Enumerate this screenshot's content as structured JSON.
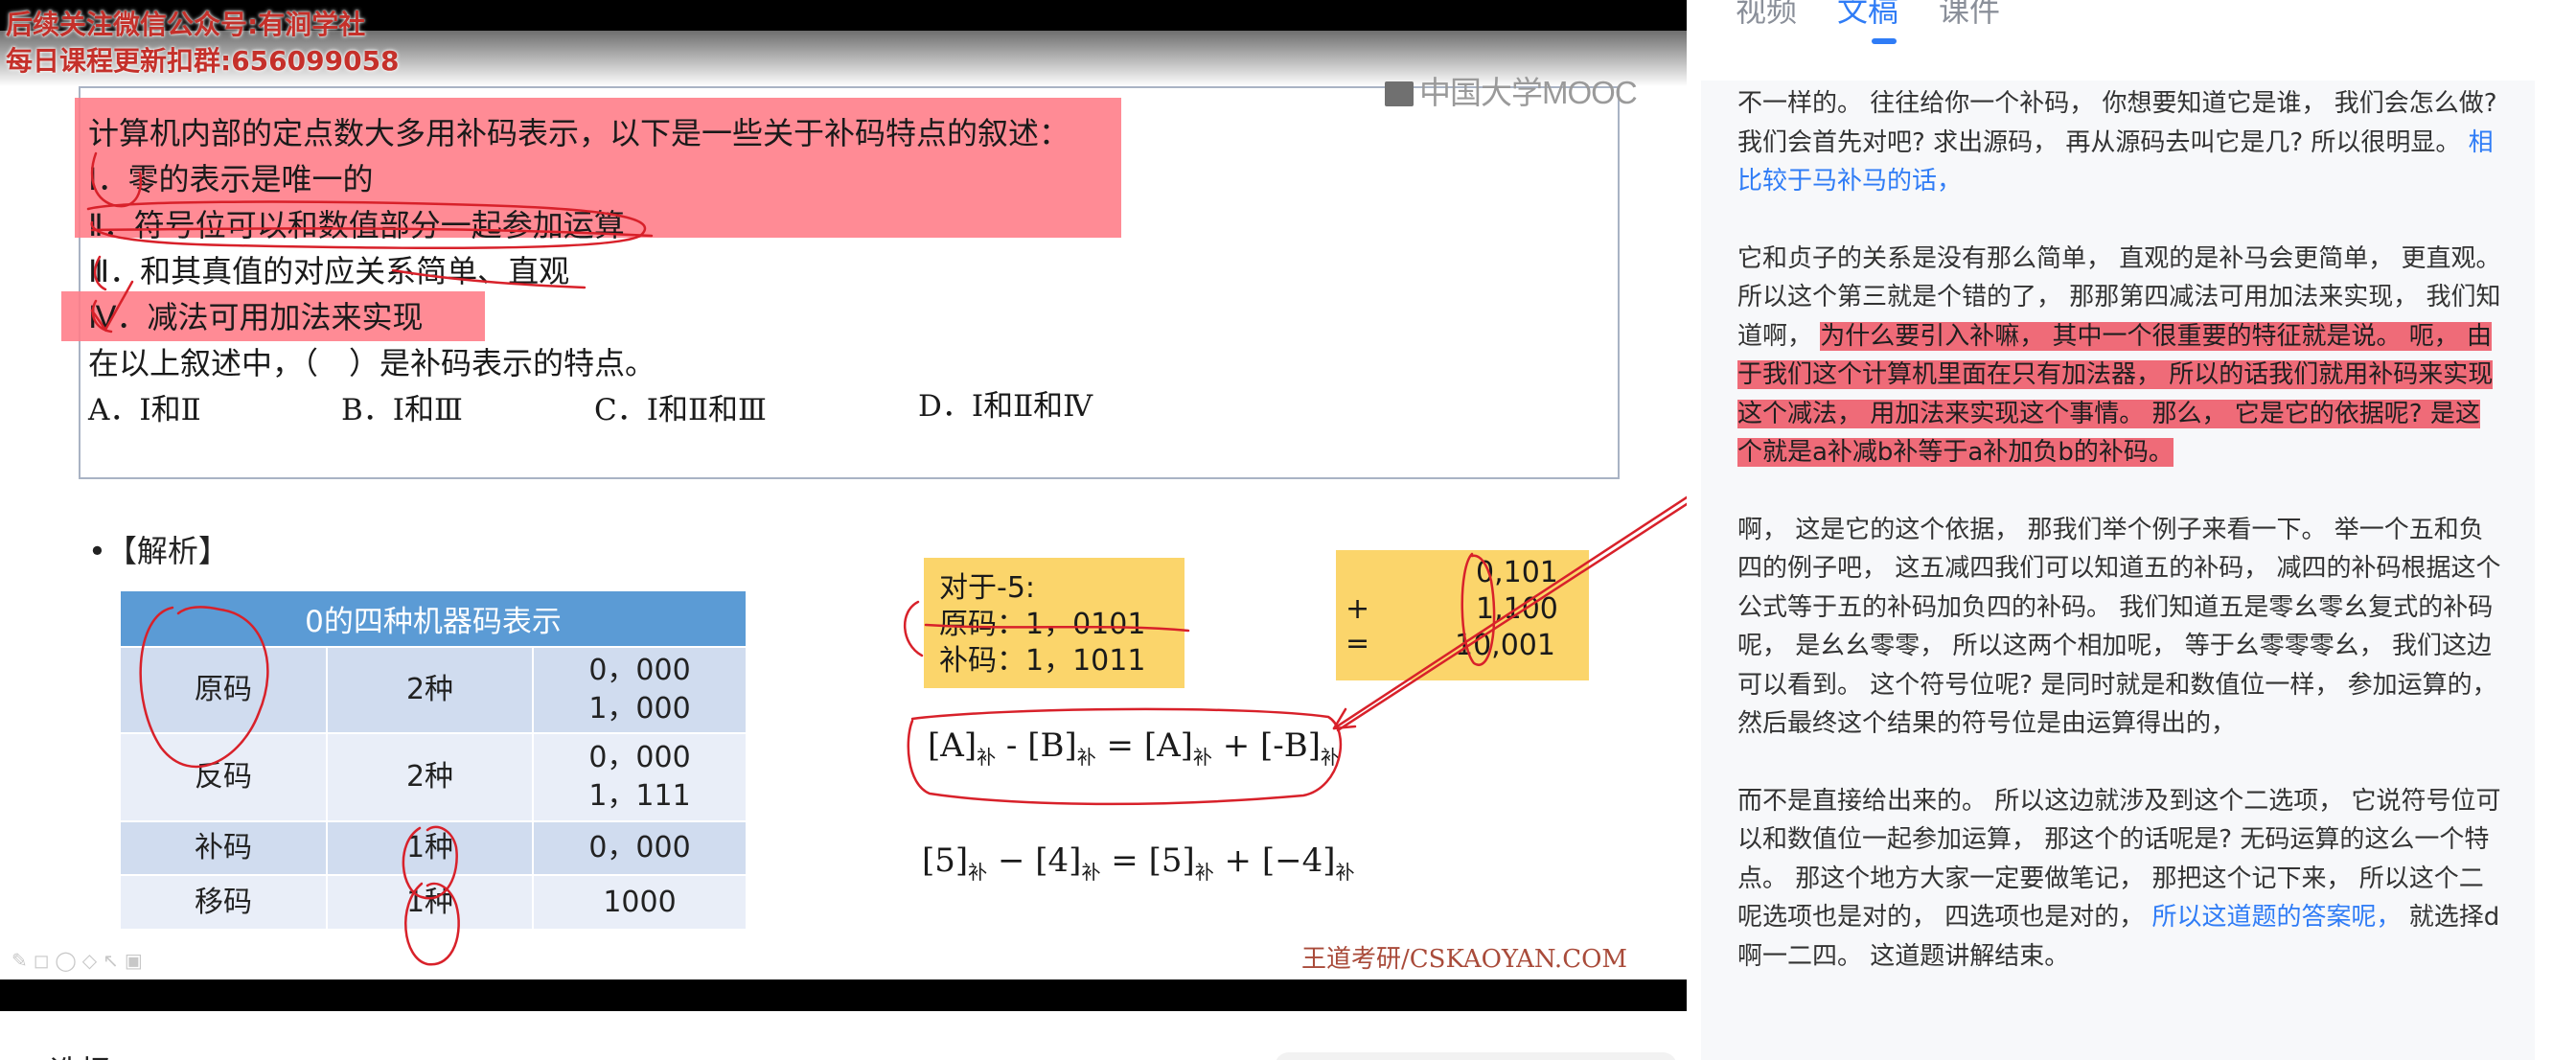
{
  "video": {
    "watermark_line1": "后续关注微信公众号:有涧学社",
    "watermark_line2": "每日课程更新扣群:656099058",
    "brand": "中国大学MOOC",
    "question": {
      "stem": "计算机内部的定点数大多用补码表示，以下是一些关于补码特点的叙述：",
      "items": [
        "Ⅰ．零的表示是唯一的",
        "Ⅱ．符号位可以和数值部分一起参加运算",
        "Ⅲ．和其真值的对应关系简单、直观",
        "Ⅳ．减法可用加法来实现"
      ],
      "prompt": "在以上叙述中，（　）是补码表示的特点。",
      "options": [
        "A．Ⅰ和Ⅱ",
        "B．Ⅰ和Ⅲ",
        "C．Ⅰ和Ⅱ和Ⅲ",
        "D．Ⅰ和Ⅱ和Ⅳ"
      ]
    },
    "analysis_label": "•【解析】",
    "table": {
      "header": "0的四种机器码表示",
      "rows": [
        {
          "name": "原码",
          "count": "2种",
          "value_line1": "0，000",
          "value_line2": "1，000"
        },
        {
          "name": "反码",
          "count": "2种",
          "value_line1": "0，000",
          "value_line2": "1，111"
        },
        {
          "name": "补码",
          "count": "1种",
          "value_line1": "0，000",
          "value_line2": ""
        },
        {
          "name": "移码",
          "count": "1种",
          "value_line1": "1000",
          "value_line2": ""
        }
      ]
    },
    "example": {
      "title": "对于-5:",
      "line1": "原码：1，0101",
      "line2": "补码：1，1011"
    },
    "addition": {
      "op_plus": "+",
      "op_eq": "=",
      "row1": "0,101",
      "row2": "1,100",
      "row3": "10,001"
    },
    "formula1": {
      "a": "[A]",
      "b": "[B]",
      "c": "[A]",
      "d": "[-B]",
      "sub": "补",
      "minus": " - ",
      "eq": " = ",
      "plus": " + "
    },
    "formula2": {
      "a": "[5]",
      "b": "[4]",
      "c": "[5]",
      "d": "[−4]",
      "sub": "补",
      "minus": " − ",
      "eq": " = ",
      "plus": " + "
    },
    "footer": "王道考研/CSKAOYAN.COM"
  },
  "below_video": {
    "section_title": "选择"
  },
  "panel": {
    "tabs": [
      {
        "label": "视频",
        "active": false
      },
      {
        "label": "文稿",
        "active": true
      },
      {
        "label": "课件",
        "active": false
      }
    ],
    "colors": {
      "accent": "#2f7cf6",
      "highlight": "#ef6b78"
    },
    "paragraphs": [
      {
        "segments": [
          {
            "text": "不一样的。 往往给你一个补码， 你想要知道它是谁， 我们会怎么做? 我们会首先对吧? 求出源码， 再从源码去叫它是几? 所以很明显。 ",
            "style": "normal"
          },
          {
            "text": "相比较于马补马的话，",
            "style": "current"
          }
        ]
      },
      {
        "segments": [
          {
            "text": "它和贞子的关系是没有那么简单， 直观的是补马会更简单， 更直观。 所以这个第三就是个错的了， 那那第四减法可用加法来实现， 我们知道啊， ",
            "style": "normal"
          },
          {
            "text": "为什么要引入补嘛， 其中一个很重要的特征就是说。 呃， 由于我们这个计算机里面在只有加法器， 所以的话我们就用补码来实现这个减法， 用加法来实现这个事情。 那么， 它是它的依据呢? 是这个就是a补减b补等于a补加负b的补码。",
            "style": "highlight"
          }
        ]
      },
      {
        "segments": [
          {
            "text": "啊， 这是它的这个依据， 那我们举个例子来看一下。 举一个五和负四的例子吧， 这五减四我们可以知道五的补码， 减四的补码根据这个公式等于五的补码加负四的补码。 我们知道五是零幺零幺复式的补码呢， 是幺幺零零， 所以这两个相加呢， 等于幺零零零幺， 我们这边可以看到。 这个符号位呢? 是同时就是和数值位一样， 参加运算的， 然后最终这个结果的符号位是由运算得出的，",
            "style": "normal"
          }
        ]
      },
      {
        "segments": [
          {
            "text": "而不是直接给出来的。 所以这边就涉及到这个二选项， 它说符号位可以和数值位一起参加运算， 那这个的话呢是? 无码运算的这么一个特点。 那这个地方大家一定要做笔记， 那把这个记下来， 所以这个二呢选项也是对的， 四选项也是对的， ",
            "style": "normal"
          },
          {
            "text": "所以这道题的答案呢，",
            "style": "current"
          },
          {
            "text": " 就选择d啊一二四。 这道题讲解结束。",
            "style": "normal"
          }
        ]
      }
    ]
  }
}
